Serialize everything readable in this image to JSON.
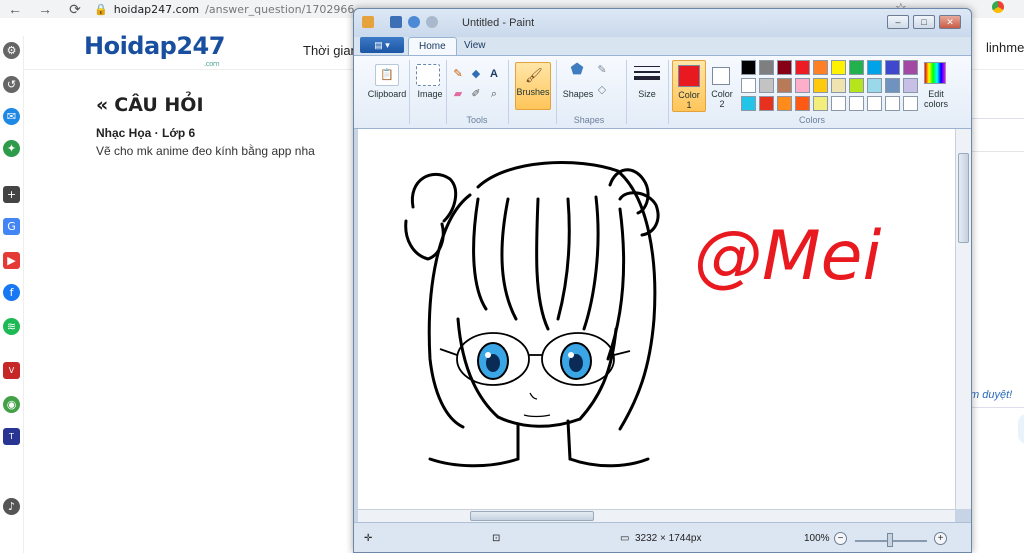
{
  "browser": {
    "url_host": "hoidap247.com",
    "url_path": "/answer_question/1702966"
  },
  "site": {
    "logo": "Hoidap247",
    "logo_sub": ".com",
    "nav_item": "Thời gian",
    "right_nav": "linhmeim",
    "question_heading": "CÂU HỎI",
    "question_meta": "Nhạc Họa · Lớp 6",
    "question_text": "Vẽ cho mk anime đeo kính bằng app nha",
    "approved_text": "m duyệt!"
  },
  "paint": {
    "title": "Untitled - Paint",
    "tabs": [
      "Home",
      "View"
    ],
    "groups": {
      "clipboard": "Clipboard",
      "image": "Image",
      "tools": "Tools",
      "brushes": "Brushes",
      "shapes": "Shapes",
      "size": "Size",
      "colors": "Colors",
      "color1": "Color",
      "color1_num": "1",
      "color2": "Color",
      "color2_num": "2",
      "edit_colors": "Edit colors"
    },
    "color1": "#e8191f",
    "color2": "#ffffff",
    "palette": [
      "#000000",
      "#7f7f7f",
      "#880015",
      "#ed1c24",
      "#ff7f27",
      "#fff200",
      "#22b14c",
      "#00a2e8",
      "#3f48cc",
      "#a349a4",
      "#ffffff",
      "#c3c3c3",
      "#b97a57",
      "#ffaec9",
      "#ffc90e",
      "#efe4b0",
      "#b5e61d",
      "#99d9ea",
      "#7092be",
      "#c8bfe7",
      "#24c4e8",
      "#e8301e",
      "#ff8c1a",
      "#ff5a14",
      "#f3ee7c",
      "#ffffff",
      "#ffffff",
      "#ffffff",
      "#ffffff",
      "#ffffff"
    ],
    "canvas_signature": "@Mei",
    "status_size": "3232 × 1744px",
    "zoom": "100%"
  }
}
